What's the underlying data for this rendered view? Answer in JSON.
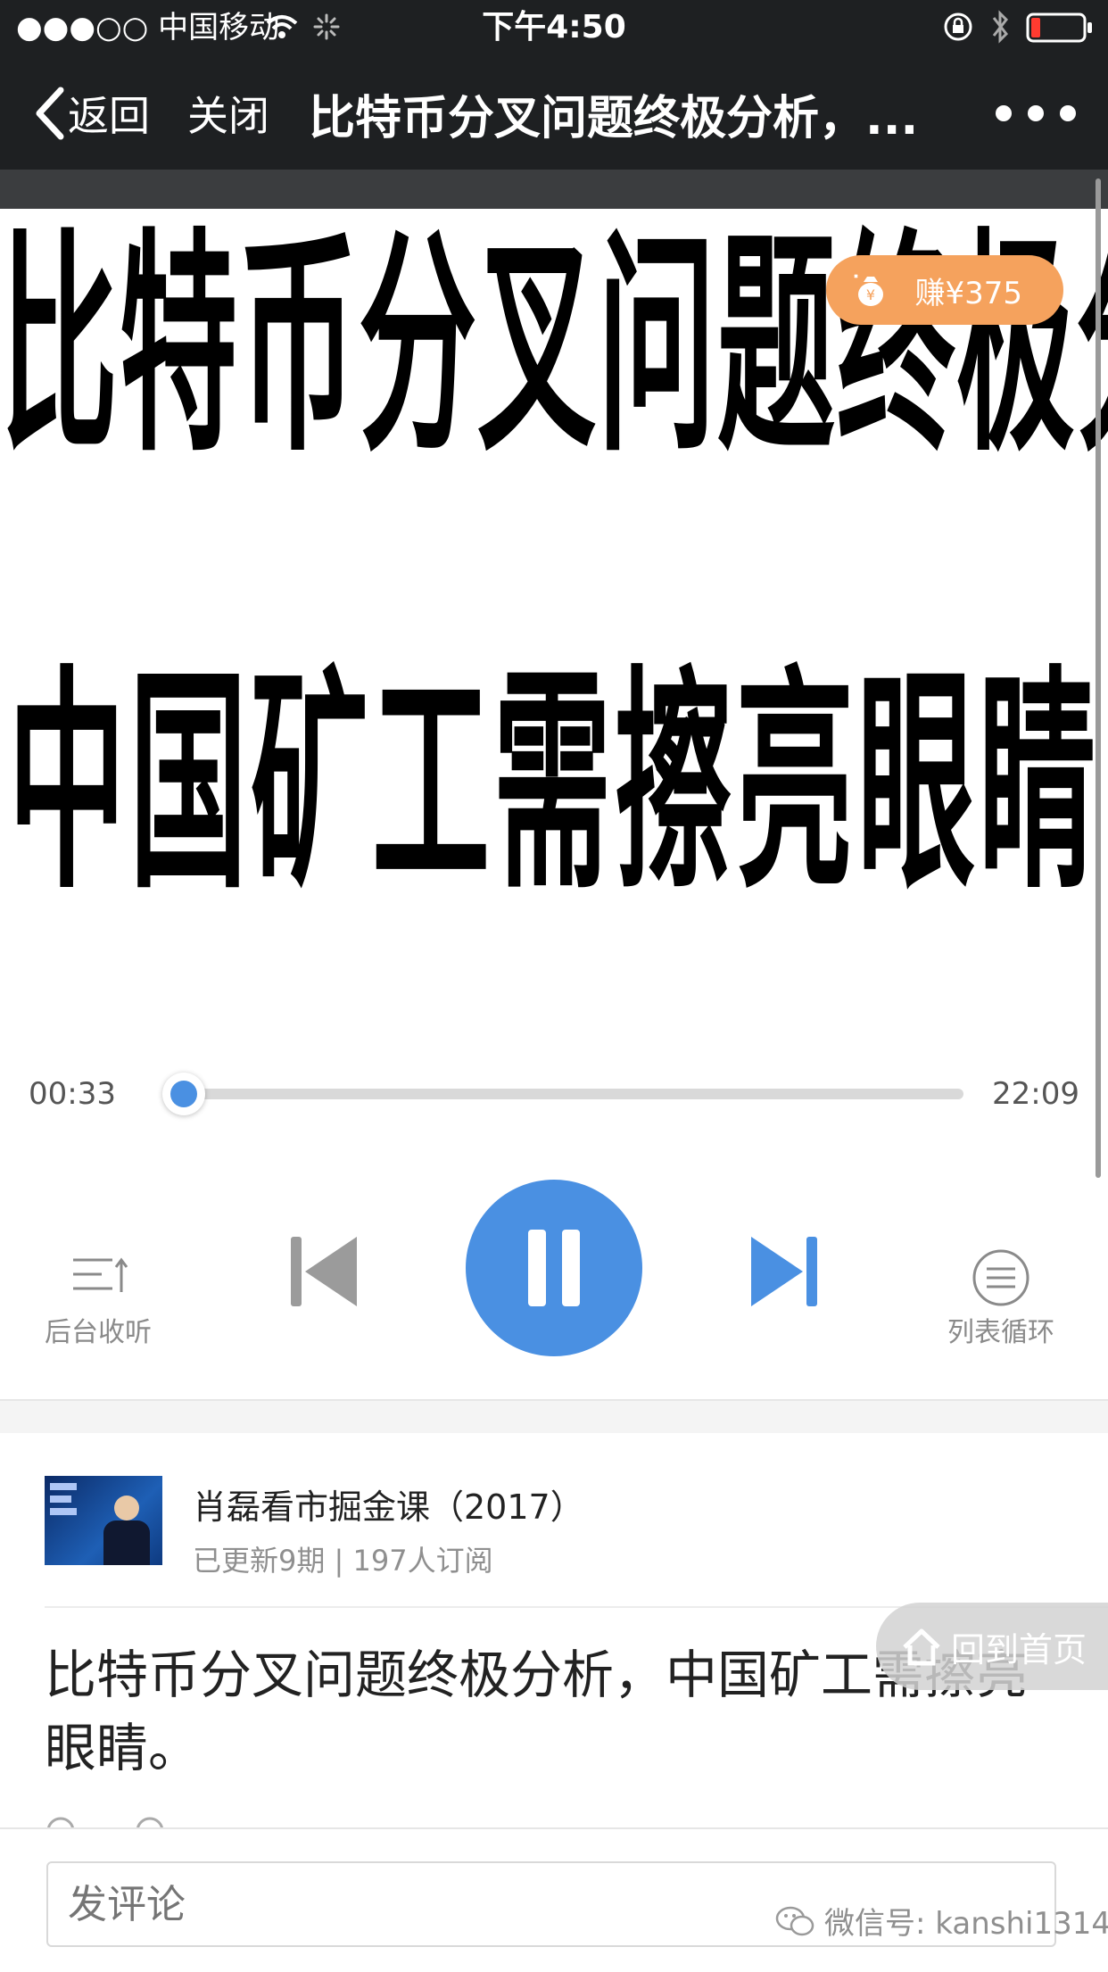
{
  "status_bar": {
    "carrier": "●●●○○ 中国移动",
    "time": "下午4:50"
  },
  "nav": {
    "back_label": "返回",
    "close_label": "关闭",
    "title": "比特币分叉问题终极分析，..."
  },
  "cover": {
    "line1": "比特币分叉问题终极分析",
    "line2": "中国矿工需擦亮眼睛"
  },
  "earn_badge": "赚¥375",
  "player": {
    "current_time": "00:33",
    "total_time": "22:09",
    "progress": 0.025,
    "background_label": "后台收听",
    "loop_label": "列表循环"
  },
  "album": {
    "title": "肖磊看市掘金课（2017）",
    "meta": "已更新9期 | 197人订阅"
  },
  "article": {
    "title": "比特币分叉问题终极分析，中国矿工需擦亮眼睛。"
  },
  "home_button": "回到首页",
  "comment": {
    "placeholder": "发评论"
  },
  "wechat_id": "微信号: kanshi1314",
  "colors": {
    "accent": "#4a90e2",
    "nav_bg": "#1e2022",
    "earn_bg": "#f5a25d"
  }
}
